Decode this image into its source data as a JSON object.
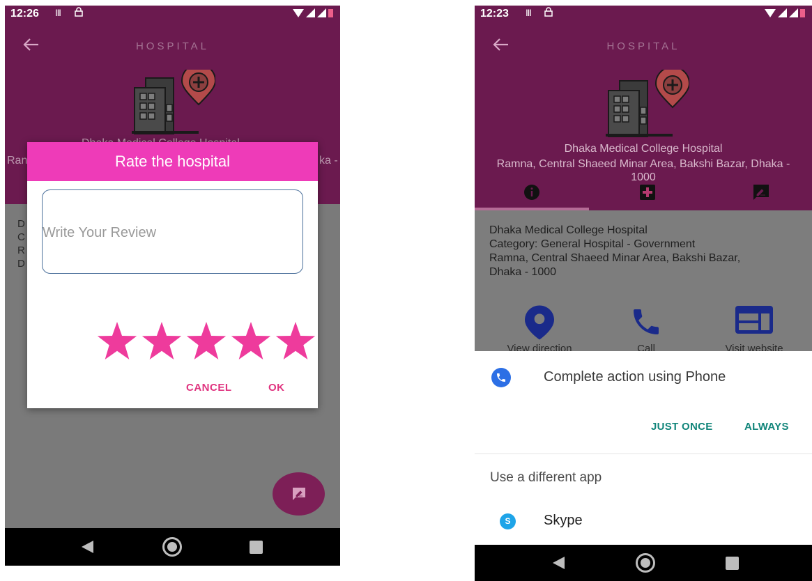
{
  "left": {
    "status": {
      "time": "12:26"
    },
    "appbar": {
      "title": "HOSPITAL"
    },
    "behind": {
      "name_fragment": "Dhaka Medical College Hospital",
      "addr_left": "Ran",
      "addr_right": "ka -",
      "body_initials": [
        "D",
        "C",
        "R",
        "D"
      ]
    },
    "dialog": {
      "title": "Rate the hospital",
      "review_placeholder": "Write Your Review",
      "stars": 5,
      "star_color": "#ee3b9c",
      "cancel_label": "CANCEL",
      "ok_label": "OK"
    }
  },
  "right": {
    "status": {
      "time": "12:23"
    },
    "appbar": {
      "title": "HOSPITAL"
    },
    "hospital": {
      "name": "Dhaka Medical College Hospital",
      "address_line1": "Ramna, Central Shaeed Minar Area, Bakshi Bazar, Dhaka -",
      "address_line2": "1000"
    },
    "tabs": [
      "info-icon",
      "hospital-cross-icon",
      "review-icon"
    ],
    "info": {
      "name": "Dhaka Medical College Hospital",
      "category": "Category: General Hospital - Government",
      "address_line1": "Ramna, Central Shaeed Minar Area, Bakshi Bazar,",
      "address_line2": "Dhaka - 1000"
    },
    "actions": [
      {
        "label": "View direction",
        "icon": "location-pin-icon"
      },
      {
        "label": "Call",
        "icon": "phone-icon"
      },
      {
        "label": "Visit website",
        "icon": "web-icon"
      }
    ],
    "chooser": {
      "title": "Complete action using Phone",
      "just_once": "JUST ONCE",
      "always": "ALWAYS",
      "different_app": "Use a different app",
      "skype_label": "Skype",
      "skype_letter": "S"
    }
  },
  "colors": {
    "header": "#6b1a4f",
    "dialog_header": "#ee3bb8",
    "accent_pink": "#e0337f",
    "teal_button": "#11857a",
    "icon_navy": "#1a2a8a"
  }
}
